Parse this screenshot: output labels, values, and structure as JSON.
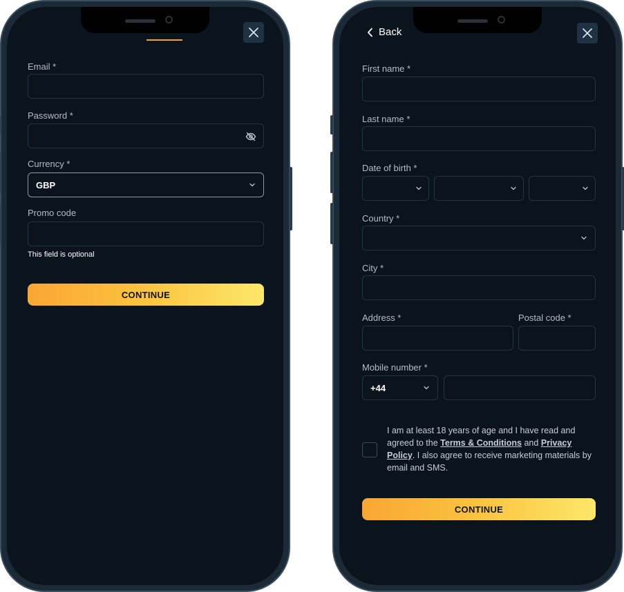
{
  "left_screen": {
    "close_icon": "close-icon",
    "email": {
      "label": "Email *",
      "value": ""
    },
    "password": {
      "label": "Password *",
      "value": "",
      "icon": "eye-off-icon"
    },
    "currency": {
      "label": "Currency *",
      "selected": "GBP"
    },
    "promo": {
      "label": "Promo code",
      "value": "",
      "hint": "This field is optional"
    },
    "continue_label": "CONTINUE"
  },
  "right_screen": {
    "back_label": "Back",
    "first_name": {
      "label": "First name *",
      "value": ""
    },
    "last_name": {
      "label": "Last name *",
      "value": ""
    },
    "dob": {
      "label": "Date of birth *",
      "day": "",
      "month": "",
      "year": ""
    },
    "country": {
      "label": "Country *",
      "selected": ""
    },
    "city": {
      "label": "City *",
      "value": ""
    },
    "address": {
      "label": "Address *",
      "value": ""
    },
    "postal_code": {
      "label": "Postal code *",
      "value": ""
    },
    "mobile": {
      "label": "Mobile number *",
      "prefix": "+44",
      "value": ""
    },
    "consent": {
      "text_1": "I am at least 18 years of age and I have read and agreed to the ",
      "terms_link": "Terms & Conditions",
      "text_2": " and ",
      "privacy_link": "Privacy Policy",
      "text_3": ". I also agree to receive marketing materials by email and SMS.",
      "checked": false
    },
    "continue_label": "CONTINUE"
  },
  "colors": {
    "screen_bg": "#0b131d",
    "field_border": "#253444",
    "accent_start": "#f9a633",
    "accent_end": "#fde76a"
  }
}
